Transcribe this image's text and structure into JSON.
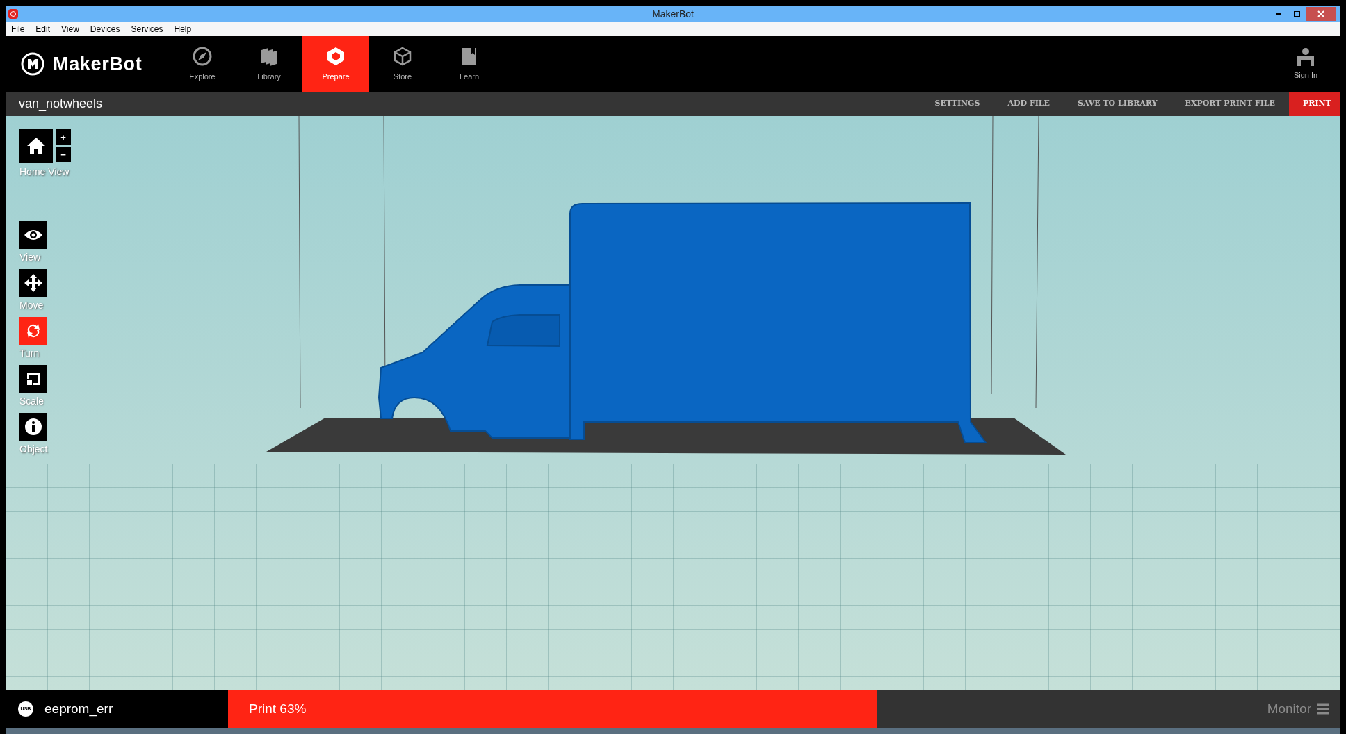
{
  "window": {
    "title": "MakerBot"
  },
  "menu": [
    "File",
    "Edit",
    "View",
    "Devices",
    "Services",
    "Help"
  ],
  "brand": "MakerBot",
  "nav_tabs": [
    {
      "label": "Explore",
      "kind": "compass",
      "selected": false
    },
    {
      "label": "Library",
      "kind": "library",
      "selected": false
    },
    {
      "label": "Prepare",
      "kind": "prepare",
      "selected": true
    },
    {
      "label": "Store",
      "kind": "store",
      "selected": false
    },
    {
      "label": "Learn",
      "kind": "learn",
      "selected": false
    }
  ],
  "sign_in": "Sign In",
  "file_name": "van_notwheels",
  "actions": [
    {
      "label": "SETTINGS",
      "primary": false
    },
    {
      "label": "ADD FILE",
      "primary": false
    },
    {
      "label": "SAVE TO LIBRARY",
      "primary": false
    },
    {
      "label": "EXPORT PRINT FILE",
      "primary": false
    },
    {
      "label": "PRINT",
      "primary": true
    }
  ],
  "zoom_buttons": [
    "+",
    "−"
  ],
  "home_view": "Home View",
  "tools": [
    {
      "label": "View",
      "kind": "eye",
      "selected": false
    },
    {
      "label": "Move",
      "kind": "move",
      "selected": false
    },
    {
      "label": "Turn",
      "kind": "turn",
      "selected": true
    },
    {
      "label": "Scale",
      "kind": "scale",
      "selected": false
    },
    {
      "label": "Object",
      "kind": "info",
      "selected": false
    }
  ],
  "status_bar": {
    "usb_badge": "USB",
    "device": "eeprom_err",
    "print_status": "Print 63%",
    "monitor": "Monitor"
  }
}
